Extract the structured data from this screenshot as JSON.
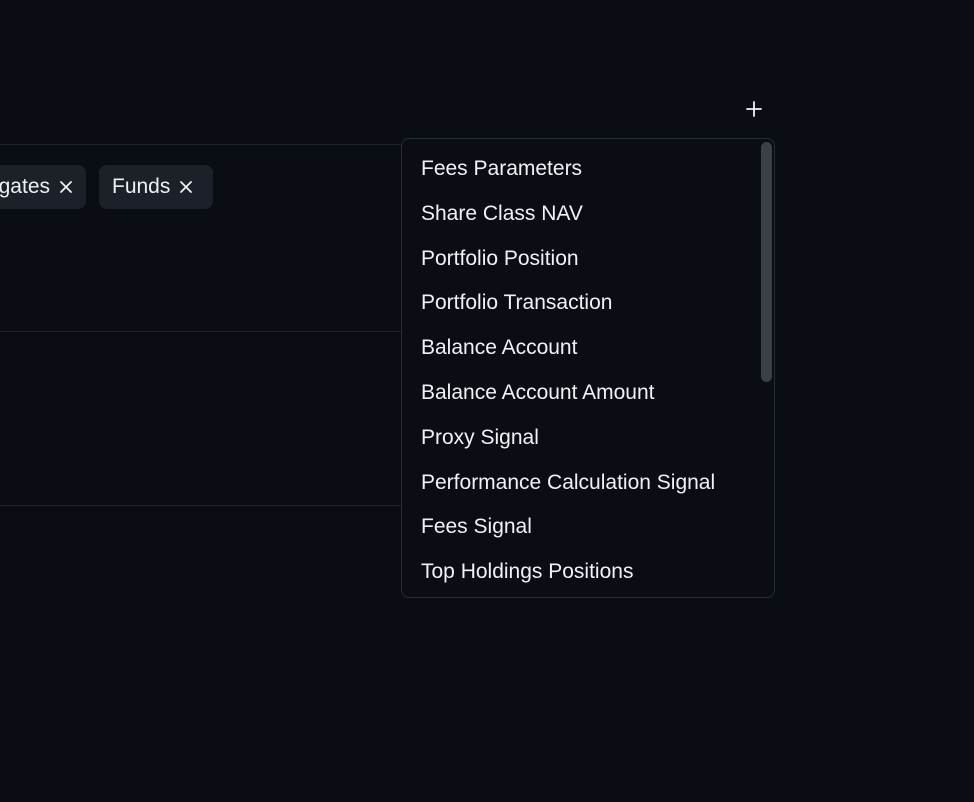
{
  "add_button": {
    "icon": "plus-icon",
    "label": "+"
  },
  "chips": [
    {
      "label": "Aggregates",
      "visible_text": "gates",
      "remove_icon": "close-icon"
    },
    {
      "label": "Funds",
      "remove_icon": "close-icon"
    }
  ],
  "dropdown": {
    "items": [
      "Fees Parameters",
      "Share Class NAV",
      "Portfolio Position",
      "Portfolio Transaction",
      "Balance Account",
      "Balance Account Amount",
      "Proxy Signal",
      "Performance Calculation Signal",
      "Fees Signal",
      "Top Holdings Positions"
    ],
    "scroll_position": 0.0
  },
  "colors": {
    "background": "#0a0d14",
    "chip_background": "#1c2029",
    "border": "#272b35",
    "text": "#f0f2f6",
    "scroll_thumb": "#3b3f48"
  }
}
